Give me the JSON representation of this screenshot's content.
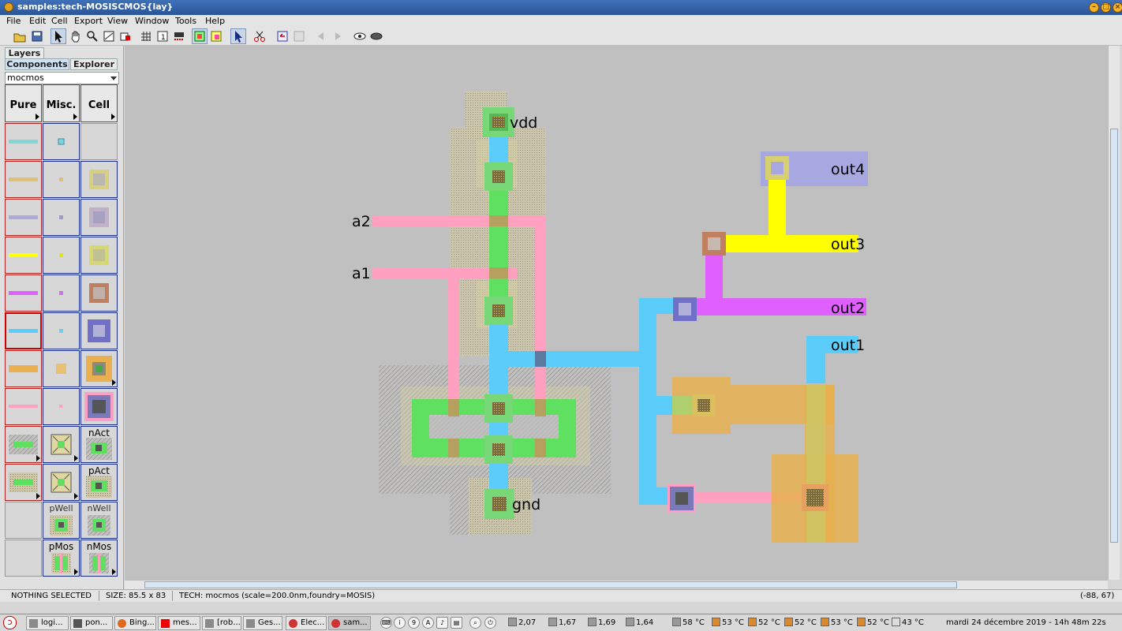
{
  "window": {
    "title": "samples:tech-MOSISCMOS{lay}",
    "controls": [
      "minimize",
      "maximize",
      "close"
    ]
  },
  "menu": [
    "File",
    "Edit",
    "Cell",
    "Export",
    "View",
    "Window",
    "Tools",
    "Help"
  ],
  "toolbar": {
    "icons": [
      "open-icon",
      "save-icon",
      "select-arrow-icon",
      "pan-hand-icon",
      "zoom-icon",
      "outline-edit-icon",
      "measure-icon",
      "grid-icon",
      "grid-size-icon",
      "full-arrow-icon",
      "highlight-objects-icon",
      "show-layers-icon",
      "select-special-icon",
      "cut-icon",
      "undo-icon",
      "redo-icon",
      "back-icon",
      "forward-icon",
      "show-icon",
      "hide-icon"
    ]
  },
  "sidebar": {
    "tabs_top": [
      "Layers"
    ],
    "tabs": [
      "Components",
      "Explorer"
    ],
    "technology": "mocmos",
    "palette_headers": [
      "Pure",
      "Misc.",
      "Cell"
    ],
    "cell_labels": {
      "nact": "nAct",
      "pact": "pAct",
      "pwell": "pWell",
      "nwell": "nWell",
      "pmos": "pMos",
      "nmos": "nMos"
    }
  },
  "layout": {
    "labels": {
      "vdd": "vdd",
      "gnd": "gnd",
      "a1": "a1",
      "a2": "a2",
      "out1": "out1",
      "out2": "out2",
      "out3": "out3",
      "out4": "out4"
    },
    "colors": {
      "canvas": "#c0c0c0",
      "metal1": "#5ccdfb",
      "poly": "#ffa0c0",
      "active": "#60e060",
      "select": "#e8b050",
      "metal2": "#a8a8e0",
      "metal3": "#ffff00",
      "metal4": "#e060ff"
    }
  },
  "status": {
    "selection": "NOTHING SELECTED",
    "size": "SIZE: 85.5 x 83",
    "tech": "TECH: mocmos (scale=200.0nm,foundry=MOSIS)",
    "coords": "(-88, 67)"
  },
  "taskbar": {
    "tasks": [
      {
        "label": "logi...",
        "icon": "folder-icon"
      },
      {
        "label": "pon...",
        "icon": "terminal-icon"
      },
      {
        "label": "Bing...",
        "icon": "browser-icon"
      },
      {
        "label": "mes...",
        "icon": "mail-icon"
      },
      {
        "label": "[rob...",
        "icon": "folder-icon"
      },
      {
        "label": "Ges...",
        "icon": "folder-icon"
      },
      {
        "label": "Elec...",
        "icon": "electric-icon"
      },
      {
        "label": "sam...",
        "icon": "electric-icon"
      }
    ],
    "cpu": [
      "2,07",
      "1,67",
      "1,69",
      "1,64"
    ],
    "temps": [
      "58 °C",
      "53 °C",
      "52 °C",
      "52 °C",
      "53 °C",
      "52 °C",
      "43 °C"
    ],
    "clock": "mardi 24 décembre 2019 - 14h 48m 22s"
  }
}
